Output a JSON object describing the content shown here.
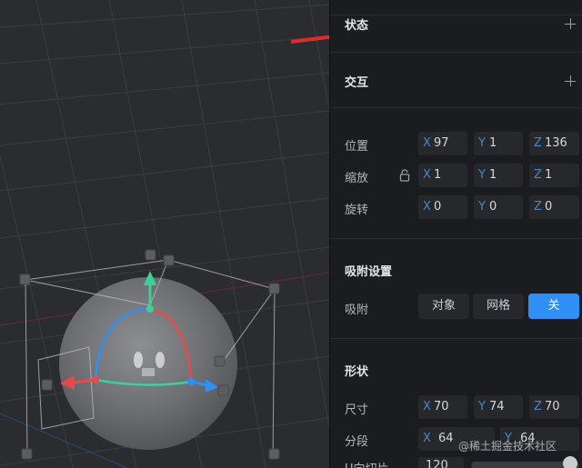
{
  "panel": {
    "state": {
      "title": "状态"
    },
    "interaction": {
      "title": "交互"
    },
    "transform": {
      "position": {
        "label": "位置",
        "x": {
          "axis": "X",
          "value": "97"
        },
        "y": {
          "axis": "Y",
          "value": "1"
        },
        "z": {
          "axis": "Z",
          "value": "136"
        }
      },
      "scale": {
        "label": "缩放",
        "x": {
          "axis": "X",
          "value": "1"
        },
        "y": {
          "axis": "Y",
          "value": "1"
        },
        "z": {
          "axis": "Z",
          "value": "1"
        }
      },
      "rotation": {
        "label": "旋转",
        "x": {
          "axis": "X",
          "value": "0"
        },
        "y": {
          "axis": "Y",
          "value": "0"
        },
        "z": {
          "axis": "Z",
          "value": "0"
        }
      }
    },
    "snap": {
      "title": "吸附设置",
      "label": "吸附",
      "options": [
        "对象",
        "网格",
        "关"
      ],
      "selected": "关"
    },
    "shape": {
      "title": "形状",
      "size": {
        "label": "尺寸",
        "x": {
          "axis": "X",
          "value": "70"
        },
        "y": {
          "axis": "Y",
          "value": "74"
        },
        "z": {
          "axis": "Z",
          "value": "70"
        }
      },
      "segments": {
        "label": "分段",
        "x": {
          "axis": "X",
          "value": "64"
        },
        "y": {
          "axis": "Y",
          "value": "64"
        }
      },
      "partial_label": "U向切片",
      "partial_value": "120"
    }
  },
  "watermark": "@稀土掘金技术社区",
  "colors": {
    "accent": "#2f8ff5",
    "arrow": "#e02b2b",
    "gizmo_x": "#e84a4a",
    "gizmo_y": "#3ad29a",
    "gizmo_z": "#2f8ff5"
  },
  "icons": [
    "plus-icon",
    "unlock-icon",
    "red-arrow-icon"
  ]
}
